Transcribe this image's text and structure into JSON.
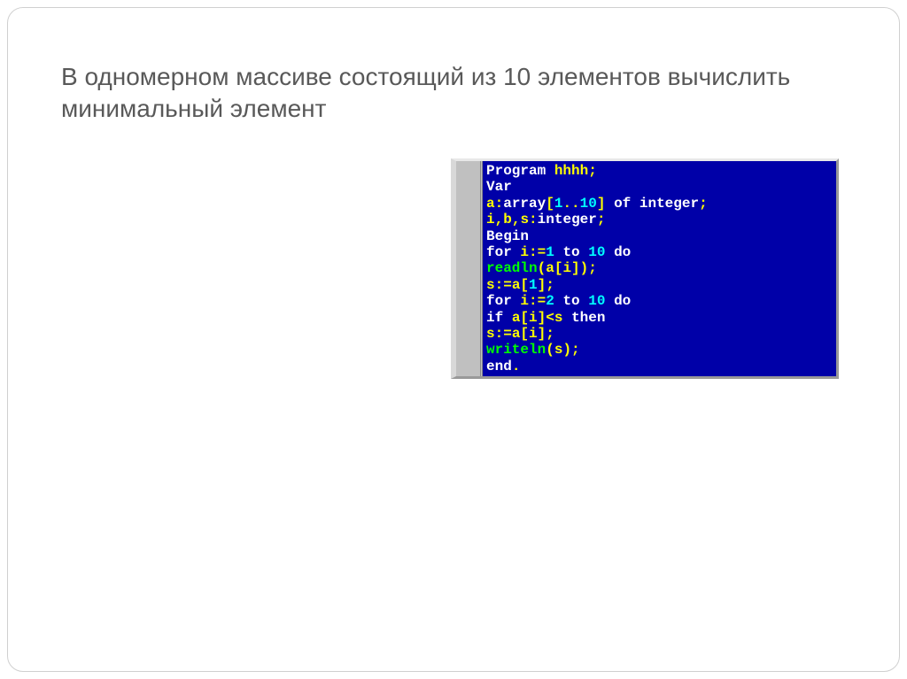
{
  "slide": {
    "title": "В одномерном массиве  состоящий из 10 элементов вычислить минимальный элемент"
  },
  "code": {
    "l1_kw": "Program",
    "l1_id": " hhhh",
    "l1_sc": ";",
    "l2_kw": "Var",
    "l3_id1": "a",
    "l3_colon": ":",
    "l3_kw_arr": "array",
    "l3_ob": "[",
    "l3_n1": "1",
    "l3_dots": "..",
    "l3_n2": "10",
    "l3_cb": "] ",
    "l3_kw_of": "of",
    "l3_sp": " ",
    "l3_kw_int": "integer",
    "l3_sc": ";",
    "l4_id": "i",
    "l4_c1": ",",
    "l4_id2": "b",
    "l4_c2": ",",
    "l4_id3": "s",
    "l4_col": ":",
    "l4_kw": "integer",
    "l4_sc": ";",
    "l5_kw": "Begin",
    "l6_kw_for": "for",
    "l6_sp1": " ",
    "l6_id": "i",
    "l6_asn": ":=",
    "l6_n1": "1",
    "l6_sp2": " ",
    "l6_kw_to": "to",
    "l6_sp3": " ",
    "l6_n2": "10",
    "l6_sp4": " ",
    "l6_kw_do": "do",
    "l7_cmd": "readln",
    "l7_op1": "(",
    "l7_id1": "a",
    "l7_op2": "[",
    "l7_id2": "i",
    "l7_op3": "]",
    "l7_op4": ");",
    "l8_id1": "s",
    "l8_asn": ":=",
    "l8_id2": "a",
    "l8_ob": "[",
    "l8_n": "1",
    "l8_cb": "]",
    "l8_sc": ";",
    "l9_kw_for": "for",
    "l9_sp1": " ",
    "l9_id": "i",
    "l9_asn": ":=",
    "l9_n1": "2",
    "l9_sp2": " ",
    "l9_kw_to": "to",
    "l9_sp3": " ",
    "l9_n2": "10",
    "l9_sp4": " ",
    "l9_kw_do": "do",
    "l10_kw_if": "if",
    "l10_sp1": " ",
    "l10_id1": "a",
    "l10_ob": "[",
    "l10_id2": "i",
    "l10_cb": "]",
    "l10_lt": "<",
    "l10_id3": "s",
    "l10_sp2": " ",
    "l10_kw_then": "then",
    "l11_id1": "s",
    "l11_asn": ":=",
    "l11_id2": "a",
    "l11_ob": "[",
    "l11_id3": "i",
    "l11_cb": "]",
    "l11_sc": ";",
    "l12_cmd": "writeln",
    "l12_op1": "(",
    "l12_id": "s",
    "l12_op2": ");",
    "l13_kw": "end",
    "l13_dot": "."
  }
}
